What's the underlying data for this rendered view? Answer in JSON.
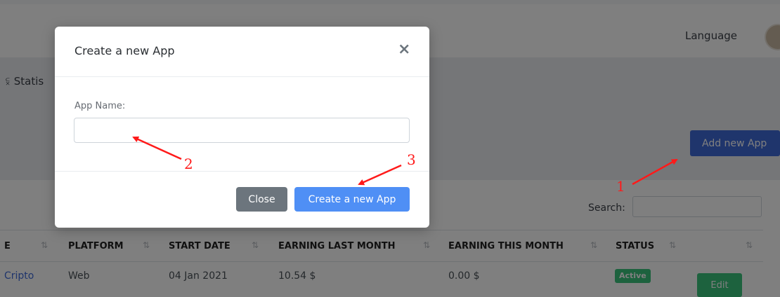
{
  "header": {
    "language_label": "Language",
    "avatar_icon": "user-avatar-icon"
  },
  "subheader": {
    "statistics_label": "Statis",
    "statistics_icon": "users-icon",
    "add_button": "Add new App"
  },
  "table": {
    "search_label": "Search:",
    "columns": [
      "E",
      "PLATFORM",
      "START DATE",
      "EARNING LAST MONTH",
      "EARNING THIS MONTH",
      "STATUS"
    ],
    "sort_icon": "sort-icon",
    "rows": [
      {
        "name": "Cripto",
        "platform": "Web",
        "start_date": "04 Jan 2021",
        "earning_last_month": "10.54 $",
        "earning_this_month": "0.00 $",
        "status": "Active",
        "action": "Edit"
      }
    ]
  },
  "modal": {
    "title": "Create a new App",
    "close_icon": "close-icon",
    "close_symbol": "×",
    "field_label": "App Name:",
    "field_value": "",
    "close_button": "Close",
    "create_button": "Create a new App"
  },
  "annotations": {
    "color": "#ff1a1a",
    "markers": [
      "1",
      "2",
      "3"
    ]
  },
  "colors": {
    "primary": "#3f6ad8",
    "modal_primary": "#4f8ff5",
    "secondary": "#6c757d",
    "success": "#3ac47d"
  }
}
